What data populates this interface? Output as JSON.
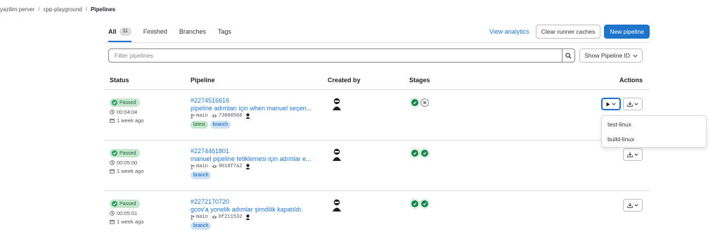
{
  "breadcrumb": {
    "items": [
      "yazilim perver",
      "cpp-playground"
    ],
    "current": "Pipelines",
    "separator": "/"
  },
  "tabs": [
    {
      "label": "All",
      "count": "11",
      "active": true
    },
    {
      "label": "Finished"
    },
    {
      "label": "Branches"
    },
    {
      "label": "Tags"
    }
  ],
  "top_actions": {
    "analytics_link": "View analytics",
    "clear_caches": "Clear runner caches",
    "new_pipeline": "New pipeline"
  },
  "filter": {
    "placeholder": "Filter pipelines",
    "show_select": "Show Pipeline ID"
  },
  "table": {
    "headers": {
      "status": "Status",
      "pipeline": "Pipeline",
      "created_by": "Created by",
      "stages": "Stages",
      "actions": "Actions"
    },
    "rows": [
      {
        "status": "Passed",
        "duration": "00:04:04",
        "finished": "1 week ago",
        "id": "#2274516616",
        "message": "pipeline adımları için when manuel seçen...",
        "ref": "main",
        "sha": "73000568",
        "tags": [
          "latest",
          "branch"
        ],
        "stages": [
          "success",
          "skipped"
        ]
      },
      {
        "status": "Passed",
        "duration": "00:05:00",
        "finished": "1 week ago",
        "id": "#2274461801",
        "message": "manuel pipeline tetiklemesi için adımlar e...",
        "ref": "main",
        "sha": "9018f7a2",
        "tags": [
          "branch"
        ],
        "stages": [
          "success",
          "success"
        ]
      },
      {
        "status": "Passed",
        "duration": "00:05:01",
        "finished": "1 week ago",
        "id": "#2272170720",
        "message": "gcov'a yonelik adımlar şimdilik kapatıldı.",
        "ref": "main",
        "sha": "0f211532",
        "tags": [
          "branch"
        ],
        "stages": [
          "success",
          "success"
        ]
      }
    ]
  },
  "manual_dropdown": {
    "items": [
      "test-linux",
      "build-linux"
    ]
  },
  "colors": {
    "primary": "#1f75cb",
    "success": "#108548",
    "passed_bg": "#c3e6cd",
    "branch_bg": "#cbe2f9"
  }
}
